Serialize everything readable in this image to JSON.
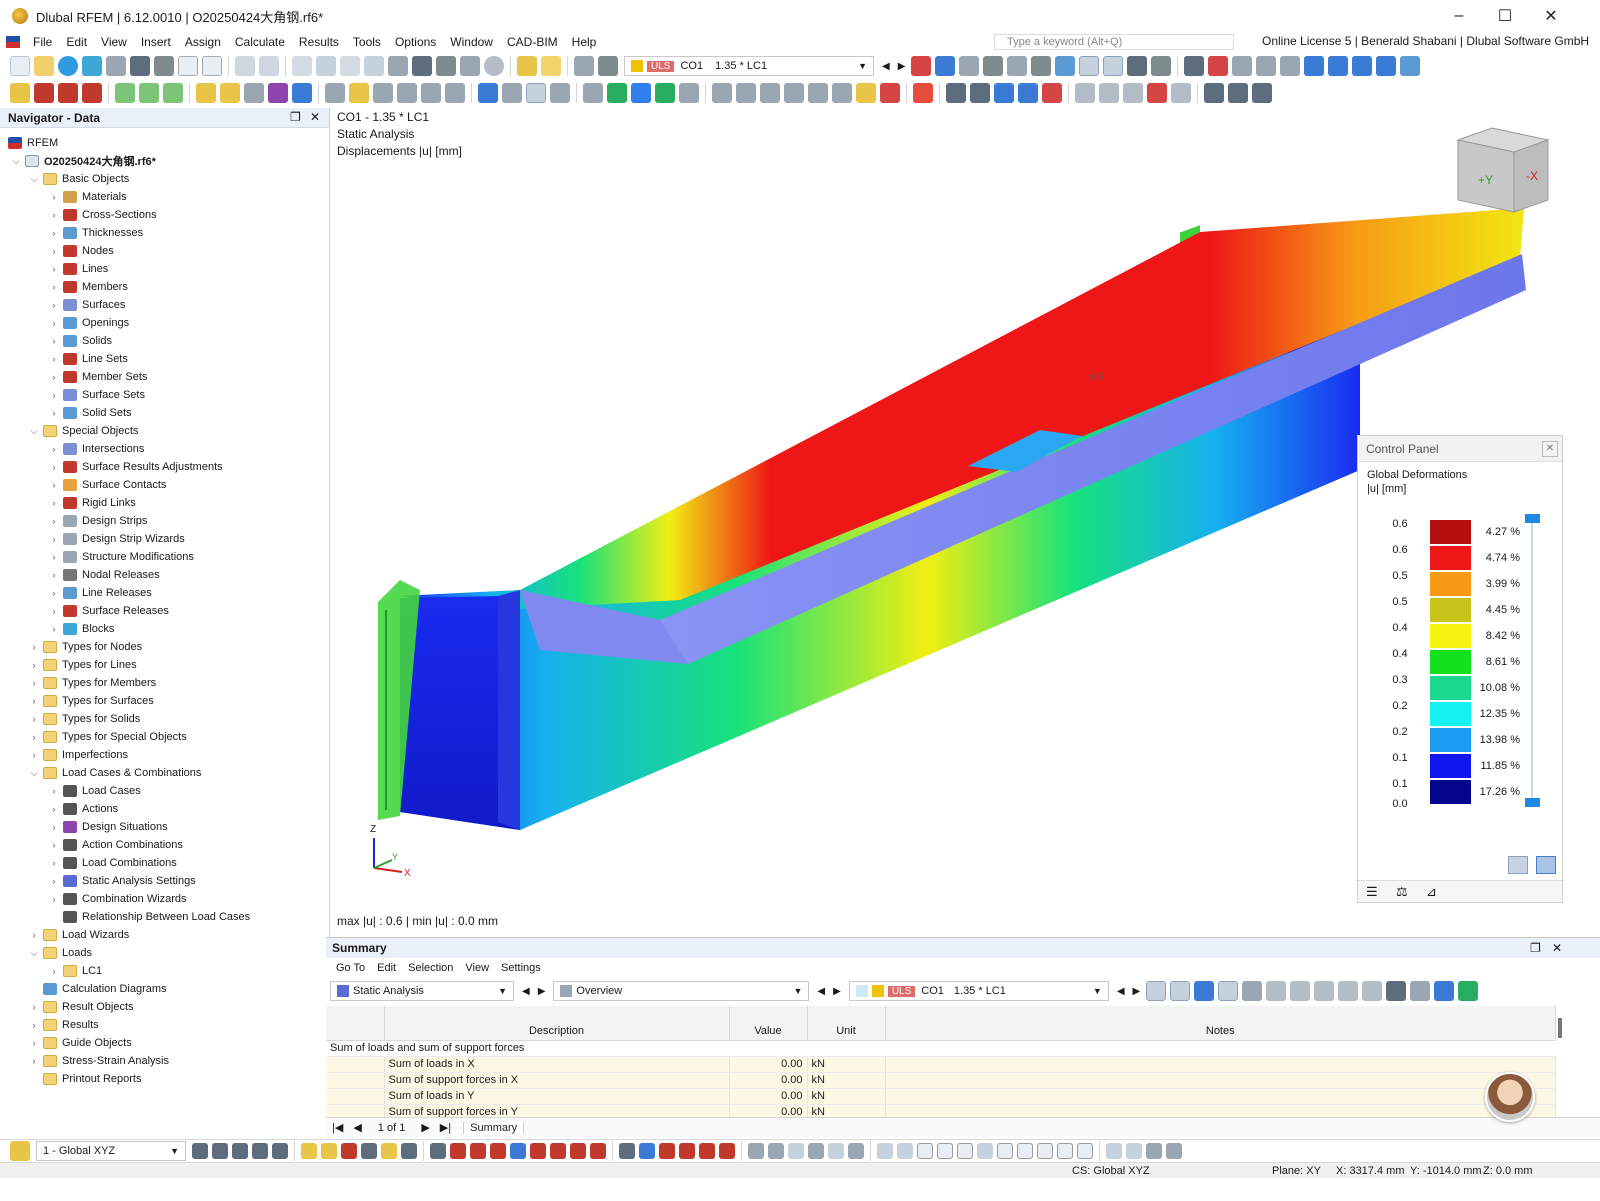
{
  "window": {
    "title": "Dlubal RFEM | 6.12.0010 | O20250424大角钢.rf6*",
    "controls": [
      "–",
      "☐",
      "✕"
    ]
  },
  "menu": {
    "items": [
      "File",
      "Edit",
      "View",
      "Insert",
      "Assign",
      "Calculate",
      "Results",
      "Tools",
      "Options",
      "Window",
      "CAD-BIM",
      "Help"
    ],
    "search_placeholder": "Type a keyword (Alt+Q)",
    "license": "Online License 5 | Benerald Shabani | Dlubal Software GmbH"
  },
  "toolbar": {
    "load_badge": "ULS",
    "load_code": "CO1",
    "load_desc": "1.35 * LC1"
  },
  "navigator": {
    "title": "Navigator - Data",
    "root": "RFEM",
    "file": "O20250424大角钢.rf6*",
    "tree": [
      {
        "label": "Basic Objects",
        "level": 1,
        "expanded": true,
        "folder": true
      },
      {
        "label": "Materials",
        "level": 2,
        "icon_color": "#d4a14a"
      },
      {
        "label": "Cross-Sections",
        "level": 2,
        "icon_color": "#c0392b"
      },
      {
        "label": "Thicknesses",
        "level": 2,
        "icon_color": "#5b9bd5"
      },
      {
        "label": "Nodes",
        "level": 2,
        "icon_color": "#c0392b"
      },
      {
        "label": "Lines",
        "level": 2,
        "icon_color": "#c0392b"
      },
      {
        "label": "Members",
        "level": 2,
        "icon_color": "#c0392b"
      },
      {
        "label": "Surfaces",
        "level": 2,
        "icon_color": "#7c8fd6"
      },
      {
        "label": "Openings",
        "level": 2,
        "icon_color": "#5b9bd5"
      },
      {
        "label": "Solids",
        "level": 2,
        "icon_color": "#5b9bd5"
      },
      {
        "label": "Line Sets",
        "level": 2,
        "icon_color": "#c0392b"
      },
      {
        "label": "Member Sets",
        "level": 2,
        "icon_color": "#c0392b"
      },
      {
        "label": "Surface Sets",
        "level": 2,
        "icon_color": "#7c8fd6"
      },
      {
        "label": "Solid Sets",
        "level": 2,
        "icon_color": "#5b9bd5"
      },
      {
        "label": "Special Objects",
        "level": 1,
        "expanded": true,
        "folder": true
      },
      {
        "label": "Intersections",
        "level": 2,
        "icon_color": "#7c8fd6"
      },
      {
        "label": "Surface Results Adjustments",
        "level": 2,
        "icon_color": "#c0392b"
      },
      {
        "label": "Surface Contacts",
        "level": 2,
        "icon_color": "#e6a23c"
      },
      {
        "label": "Rigid Links",
        "level": 2,
        "icon_color": "#c0392b"
      },
      {
        "label": "Design Strips",
        "level": 2,
        "icon_color": "#9aa7b3"
      },
      {
        "label": "Design Strip Wizards",
        "level": 2,
        "icon_color": "#9aa7b3"
      },
      {
        "label": "Structure Modifications",
        "level": 2,
        "icon_color": "#9aa7b3"
      },
      {
        "label": "Nodal Releases",
        "level": 2,
        "icon_color": "#777777"
      },
      {
        "label": "Line Releases",
        "level": 2,
        "icon_color": "#5b9bd5"
      },
      {
        "label": "Surface Releases",
        "level": 2,
        "icon_color": "#c0392b"
      },
      {
        "label": "Blocks",
        "level": 2,
        "icon_color": "#3fa7d6"
      },
      {
        "label": "Types for Nodes",
        "level": 1,
        "folder": true
      },
      {
        "label": "Types for Lines",
        "level": 1,
        "folder": true
      },
      {
        "label": "Types for Members",
        "level": 1,
        "folder": true
      },
      {
        "label": "Types for Surfaces",
        "level": 1,
        "folder": true
      },
      {
        "label": "Types for Solids",
        "level": 1,
        "folder": true
      },
      {
        "label": "Types for Special Objects",
        "level": 1,
        "folder": true
      },
      {
        "label": "Imperfections",
        "level": 1,
        "folder": true
      },
      {
        "label": "Load Cases & Combinations",
        "level": 1,
        "expanded": true,
        "folder": true
      },
      {
        "label": "Load Cases",
        "level": 2,
        "icon_color": "#555555"
      },
      {
        "label": "Actions",
        "level": 2,
        "icon_color": "#555555"
      },
      {
        "label": "Design Situations",
        "level": 2,
        "icon_color": "#8e44ad"
      },
      {
        "label": "Action Combinations",
        "level": 2,
        "icon_color": "#555555"
      },
      {
        "label": "Load Combinations",
        "level": 2,
        "icon_color": "#555555"
      },
      {
        "label": "Static Analysis Settings",
        "level": 2,
        "icon_color": "#5b6bd5"
      },
      {
        "label": "Combination Wizards",
        "level": 2,
        "icon_color": "#555555"
      },
      {
        "label": "Relationship Between Load Cases",
        "level": 2,
        "icon_color": "#555555",
        "no_chevron": true
      },
      {
        "label": "Load Wizards",
        "level": 1,
        "folder": true
      },
      {
        "label": "Loads",
        "level": 1,
        "expanded": true,
        "folder": true
      },
      {
        "label": "LC1",
        "level": 2,
        "folder": true
      },
      {
        "label": "Calculation Diagrams",
        "level": 1,
        "icon_color": "#5b9bd5",
        "no_chevron": true
      },
      {
        "label": "Result Objects",
        "level": 1,
        "folder": true
      },
      {
        "label": "Results",
        "level": 1,
        "folder": true
      },
      {
        "label": "Guide Objects",
        "level": 1,
        "folder": true
      },
      {
        "label": "Stress-Strain Analysis",
        "level": 1,
        "folder": true
      },
      {
        "label": "Printout Reports",
        "level": 1,
        "folder": true,
        "no_chevron": true
      }
    ]
  },
  "viewport": {
    "line1": "CO1 - 1.35 * LC1",
    "line2": "Static Analysis",
    "line3": "Displacements |u| [mm]",
    "minmax": "max |u| : 0.6 | min |u| : 0.0 mm",
    "axis_z": "Z",
    "axis_y": "Y",
    "axis_x": "X",
    "cube_face_1": "+Y",
    "cube_face_2": "-X",
    "model_label": "0.6"
  },
  "control_panel": {
    "title": "Control Panel",
    "section": "Global Deformations",
    "unit": "|u| [mm]",
    "legend": [
      {
        "value": "0.6",
        "color": "#b30f0f",
        "pct": "4.27 %"
      },
      {
        "value": "0.6",
        "color": "#ee1616",
        "pct": "4.74 %"
      },
      {
        "value": "0.5",
        "color": "#f89b14",
        "pct": "3.99 %"
      },
      {
        "value": "0.5",
        "color": "#c8c41a",
        "pct": "4.45 %"
      },
      {
        "value": "0.4",
        "color": "#f5f511",
        "pct": "8.42 %"
      },
      {
        "value": "0.4",
        "color": "#14e11e",
        "pct": "8.61 %"
      },
      {
        "value": "0.3",
        "color": "#1ad98e",
        "pct": "10.08 %"
      },
      {
        "value": "0.2",
        "color": "#15f0f0",
        "pct": "12.35 %"
      },
      {
        "value": "0.2",
        "color": "#1a9af0",
        "pct": "13.98 %"
      },
      {
        "value": "0.1",
        "color": "#1016f0",
        "pct": "11.85 %"
      },
      {
        "value": "0.1",
        "color": "#05058c",
        "pct": "17.26 %"
      }
    ],
    "legend_bottom_value": "0.0"
  },
  "summary": {
    "title": "Summary",
    "menu": [
      "Go To",
      "Edit",
      "Selection",
      "View",
      "Settings"
    ],
    "analysis": "Static Analysis",
    "overview": "Overview",
    "load_badge": "ULS",
    "load_code": "CO1",
    "load_desc": "1.35 * LC1",
    "columns": [
      "Description",
      "Value",
      "Unit",
      "Notes"
    ],
    "group": "Sum of loads and sum of support forces",
    "rows": [
      {
        "desc": "Sum of loads in X",
        "value": "0.00",
        "unit": "kN"
      },
      {
        "desc": "Sum of support forces in X",
        "value": "0.00",
        "unit": "kN"
      },
      {
        "desc": "Sum of loads in Y",
        "value": "0.00",
        "unit": "kN"
      },
      {
        "desc": "Sum of support forces in Y",
        "value": "0.00",
        "unit": "kN"
      }
    ],
    "pager": "1 of 1",
    "tab": "Summary"
  },
  "bottom_toolbar": {
    "coord_system": "1 - Global XYZ"
  },
  "status": {
    "cs": "CS: Global XYZ",
    "plane": "Plane: XY",
    "x": "X: 3317.4 mm",
    "y": "Y: -1014.0 mm",
    "z": "Z: 0.0 mm"
  }
}
